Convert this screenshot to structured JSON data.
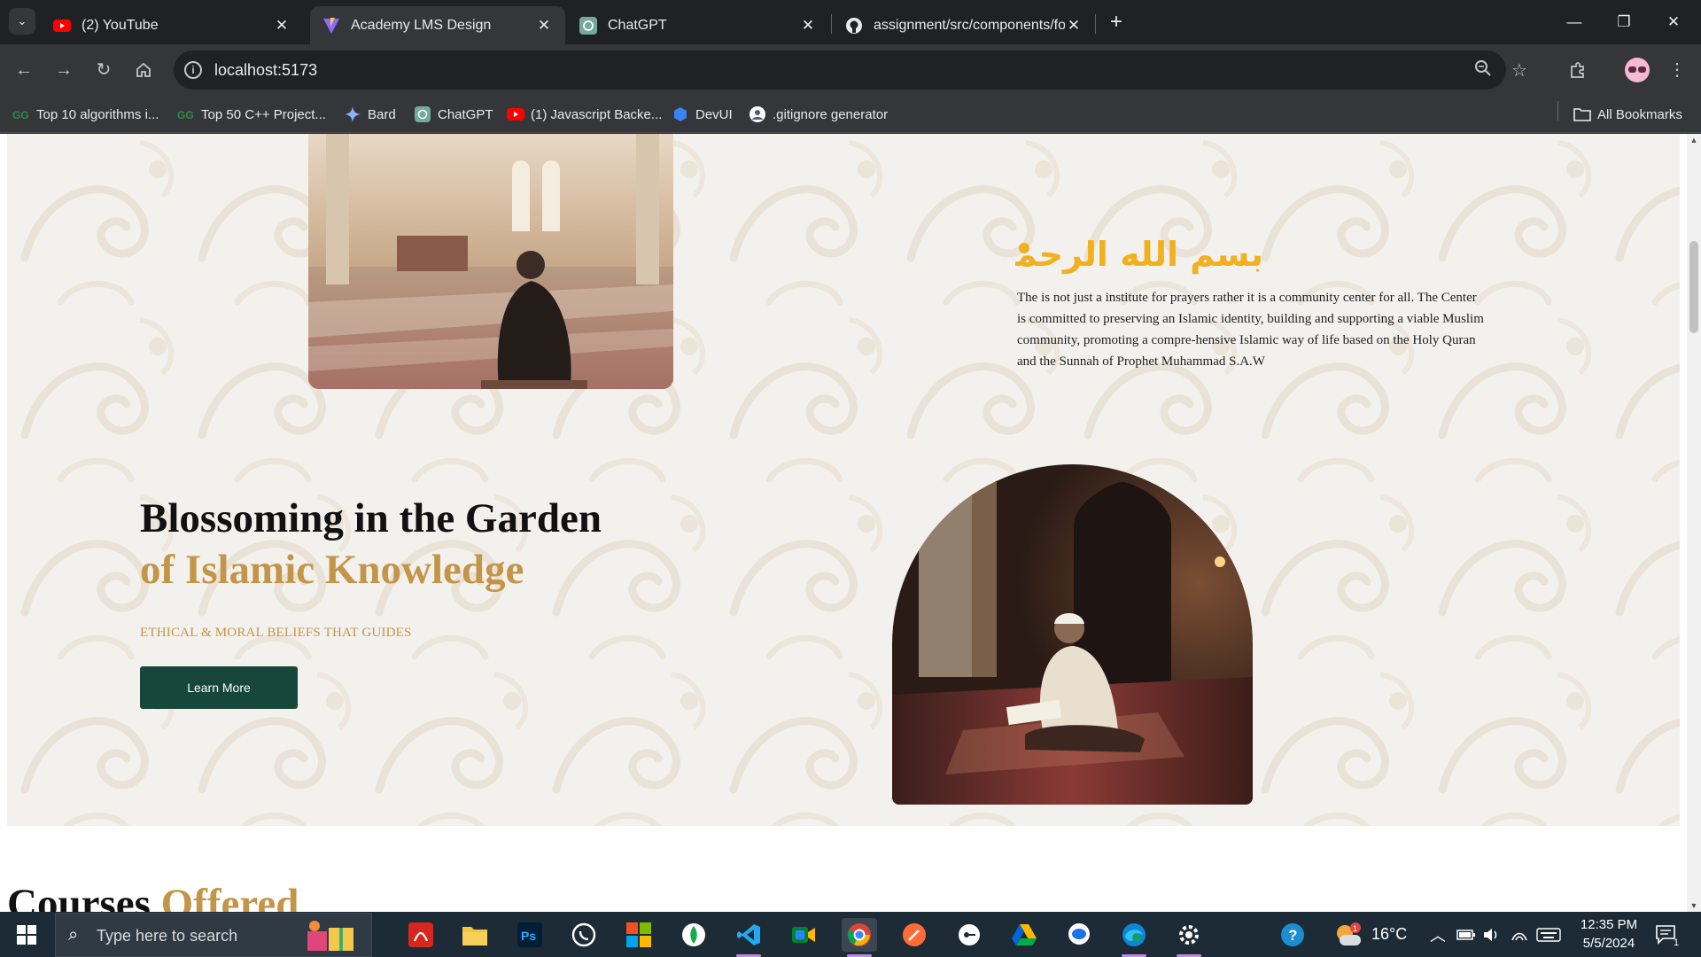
{
  "browser": {
    "tabs": [
      {
        "title": "(2) YouTube",
        "icon": "youtube-icon",
        "active": false
      },
      {
        "title": "Academy LMS Design",
        "icon": "vite-icon",
        "active": true
      },
      {
        "title": "ChatGPT",
        "icon": "chatgpt-icon",
        "active": false
      },
      {
        "title": "assignment/src/components/fo",
        "icon": "github-icon",
        "active": false
      }
    ],
    "url": "localhost:5173",
    "bookmarks": [
      {
        "label": "Top 10 algorithms i...",
        "icon": "gfg-icon"
      },
      {
        "label": "Top 50 C++ Project...",
        "icon": "gfg-icon"
      },
      {
        "label": "Bard",
        "icon": "bard-icon"
      },
      {
        "label": "ChatGPT",
        "icon": "chatgpt-icon"
      },
      {
        "label": "(1) Javascript Backe...",
        "icon": "youtube-icon"
      },
      {
        "label": "DevUI",
        "icon": "devui-icon"
      },
      {
        ".label": "",
        "label": ".gitignore generator",
        "icon": "gitignore-icon"
      }
    ],
    "all_bookmarks": "All Bookmarks"
  },
  "page": {
    "intro_text": "The is not just a institute for prayers rather it is a community center for all. The Center is committed to preserving an Islamic identity, building and supporting a viable Muslim community, promoting a compre-hensive Islamic way of life based on the Holy Quran and the Sunnah of Prophet Muhammad S.A.W",
    "calligraphy_text": "بسم الله الرحمن الرحيم",
    "hero_title_line1": "Blossoming in the Garden",
    "hero_title_line2": "of Islamic Knowledge",
    "hero_subtitle": "ETHICAL & MORAL BELIEFS THAT GUIDES",
    "learn_more": "Learn More",
    "courses_heading_a": "Courses",
    "courses_heading_b": "Offered",
    "colors": {
      "gold": "#c39548",
      "green": "#17463a",
      "cream": "#f3f1ed",
      "calligraphy": "#f2b01e"
    }
  },
  "taskbar": {
    "search_placeholder": "Type here to search",
    "weather": "16°C",
    "time": "12:35 PM",
    "date": "5/5/2024",
    "notifications": "1"
  }
}
